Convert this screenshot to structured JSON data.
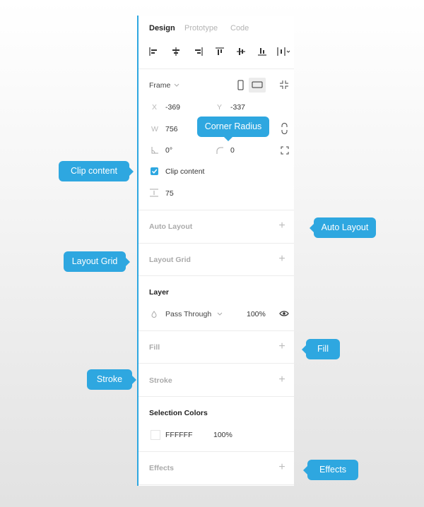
{
  "tabs": {
    "design": "Design",
    "prototype": "Prototype",
    "code": "Code"
  },
  "frame": {
    "label": "Frame",
    "x_label": "X",
    "x_value": "-369",
    "y_label": "Y",
    "y_value": "-337",
    "w_label": "W",
    "w_value": "756",
    "rotation_value": "0°",
    "radius_value": "0",
    "clip_label": "Clip content",
    "spacing_value": "75"
  },
  "sections": {
    "auto_layout": "Auto Layout",
    "layout_grid": "Layout Grid",
    "layer": "Layer",
    "fill": "Fill",
    "stroke": "Stroke",
    "selection_colors": "Selection Colors",
    "effects": "Effects"
  },
  "layer": {
    "blend_mode": "Pass Through",
    "opacity": "100%"
  },
  "selection_colors": {
    "hex": "FFFFFF",
    "opacity": "100%"
  },
  "callouts": {
    "corner_radius": "Corner Radius",
    "clip_content": "Clip content",
    "auto_layout": "Auto Layout",
    "layout_grid": "Layout Grid",
    "fill": "Fill",
    "stroke": "Stroke",
    "effects": "Effects"
  },
  "colors": {
    "accent": "#2ea7e0",
    "panel_bg": "#ffffff"
  }
}
